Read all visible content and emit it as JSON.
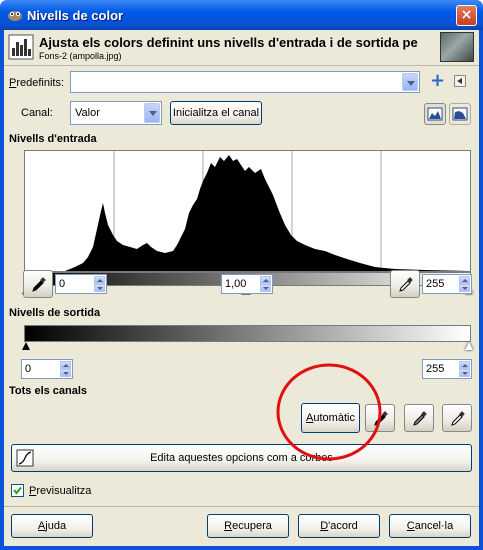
{
  "window": {
    "title": "Nivells de color",
    "close": "×"
  },
  "header": {
    "title": "Ajusta els colors definint uns nivells d'entrada i de sortida pe",
    "subtitle": "Fons-2 (ampolla.jpg)"
  },
  "presets": {
    "label": "Predefinits:",
    "value": ""
  },
  "channel": {
    "label": "Canal:",
    "value": "Valor",
    "reset_label": "Inicialitza el canal"
  },
  "input_levels": {
    "heading": "Nivells d'entrada",
    "low": "0",
    "gamma": "1,00",
    "high": "255"
  },
  "output_levels": {
    "heading": "Nivells de sortida",
    "low": "0",
    "high": "255"
  },
  "all_channels": {
    "heading": "Tots els canals",
    "auto_label": "Automàtic"
  },
  "curves_button": "Edita aquestes opcions com a corbes",
  "preview": {
    "label": "Previsualitza",
    "checked": true
  },
  "footer": {
    "help": "Ajuda",
    "reset": "Recupera",
    "ok": "D'acord",
    "cancel": "Cancel·la"
  },
  "colors": {
    "title_bar": "#0058e6",
    "dialog_bg": "#ece9d8",
    "highlight": "#e01010"
  }
}
